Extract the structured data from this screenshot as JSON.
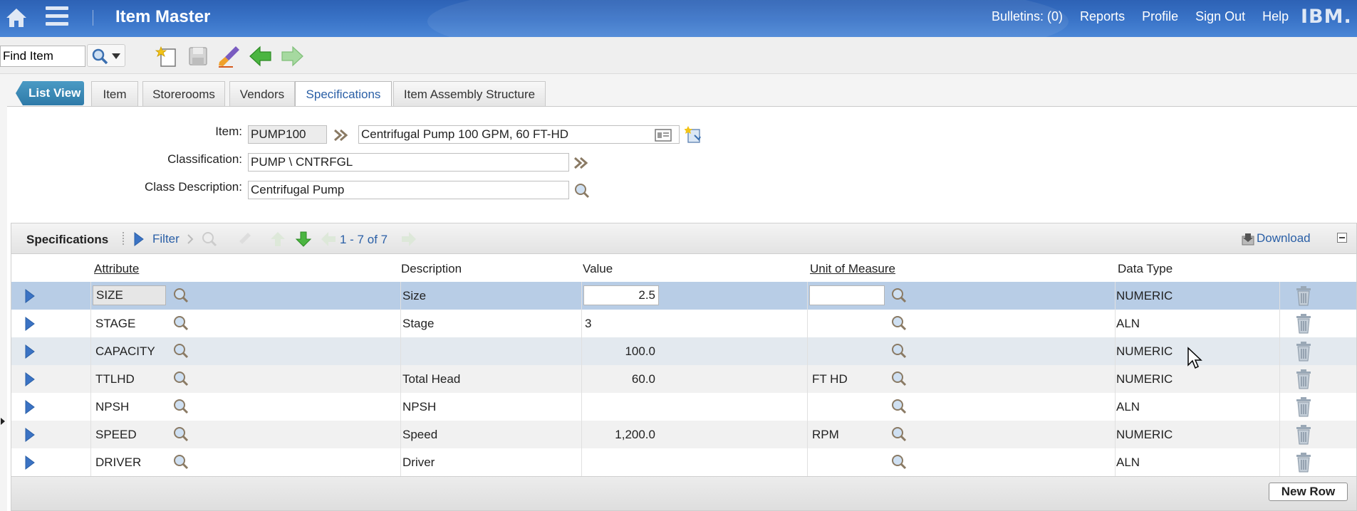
{
  "header": {
    "title": "Item Master",
    "links": [
      "Bulletins: (0)",
      "Reports",
      "Profile",
      "Sign Out",
      "Help"
    ],
    "logo": "IBM."
  },
  "toolbar": {
    "find_value": "Find Item",
    "icons": [
      "search-icon",
      "new-record-icon",
      "save-icon",
      "clear-changes-icon",
      "previous-record-icon",
      "next-record-icon"
    ]
  },
  "tabs": {
    "list_view": "List View",
    "items": [
      "Item",
      "Storerooms",
      "Vendors",
      "Specifications",
      "Item Assembly Structure"
    ],
    "active": "Specifications"
  },
  "form": {
    "item_label": "Item:",
    "item_value": "PUMP100",
    "item_desc": "Centrifugal Pump 100 GPM, 60 FT-HD",
    "class_label": "Classification:",
    "class_value": "PUMP \\ CNTRFGL",
    "class_desc_label": "Class Description:",
    "class_desc_value": "Centrifugal Pump"
  },
  "table": {
    "title": "Specifications",
    "filter_label": "Filter",
    "count": "1 - 7 of 7",
    "download_label": "Download",
    "columns": [
      "Attribute",
      "Description",
      "Value",
      "Unit of Measure",
      "Data Type"
    ],
    "rows": [
      {
        "attribute": "SIZE",
        "description": "Size",
        "value": "2.5",
        "uom": "",
        "datatype": "NUMERIC"
      },
      {
        "attribute": "STAGE",
        "description": "Stage",
        "value": "3",
        "uom": "",
        "datatype": "ALN"
      },
      {
        "attribute": "CAPACITY",
        "description": "",
        "value": "100.0",
        "uom": "",
        "datatype": "NUMERIC"
      },
      {
        "attribute": "TTLHD",
        "description": "Total Head",
        "value": "60.0",
        "uom": "FT HD",
        "datatype": "NUMERIC"
      },
      {
        "attribute": "NPSH",
        "description": "NPSH",
        "value": "",
        "uom": "",
        "datatype": "ALN"
      },
      {
        "attribute": "SPEED",
        "description": "Speed",
        "value": "1,200.0",
        "uom": "RPM",
        "datatype": "NUMERIC"
      },
      {
        "attribute": "DRIVER",
        "description": "Driver",
        "value": "",
        "uom": "",
        "datatype": "ALN"
      }
    ],
    "new_row_label": "New Row"
  },
  "colors": {
    "header_blue": "#3a74c8",
    "link_blue": "#2a5fa6",
    "selected_row": "#b8cde6"
  }
}
